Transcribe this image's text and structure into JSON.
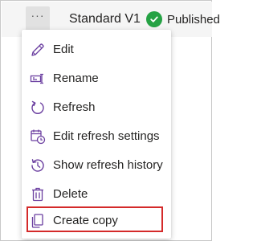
{
  "header": {
    "more_label": "···",
    "title": "Standard V1",
    "status": "Published",
    "status_color": "#25a244"
  },
  "menu": {
    "items": [
      {
        "label": "Edit",
        "icon": "pencil-icon"
      },
      {
        "label": "Rename",
        "icon": "rename-icon"
      },
      {
        "label": "Refresh",
        "icon": "refresh-icon"
      },
      {
        "label": "Edit refresh settings",
        "icon": "calendar-clock-icon"
      },
      {
        "label": "Show refresh history",
        "icon": "history-icon"
      },
      {
        "label": "Delete",
        "icon": "trash-icon"
      },
      {
        "label": "Create copy",
        "icon": "copy-icon"
      }
    ],
    "highlight_color": "#d42a2a"
  }
}
